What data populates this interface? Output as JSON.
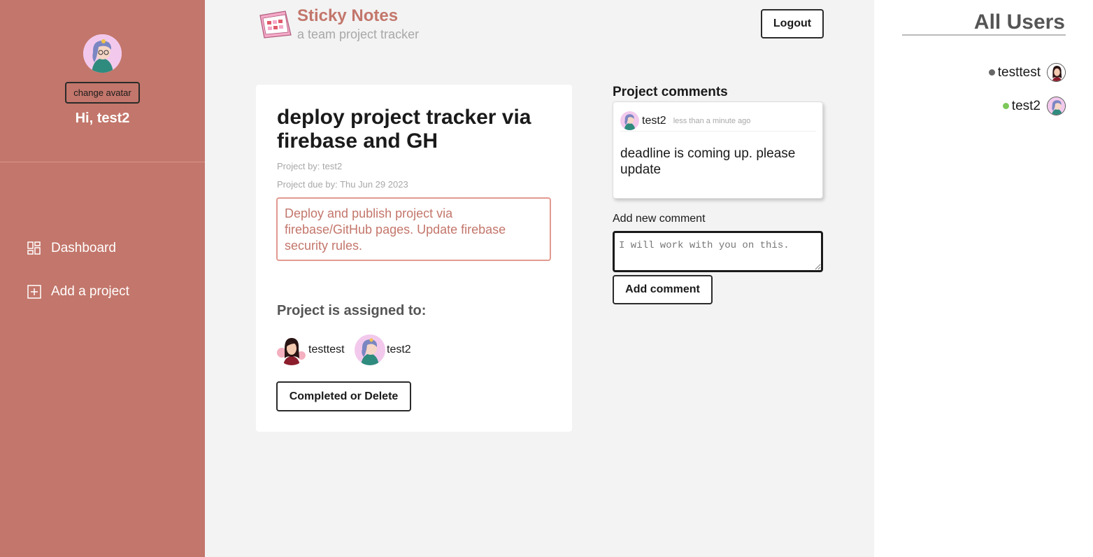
{
  "sidebar": {
    "change_avatar_label": "change avatar",
    "greeting": "Hi, test2",
    "nav": [
      {
        "label": "Dashboard",
        "icon": "dashboard-icon"
      },
      {
        "label": "Add a project",
        "icon": "add-square-icon"
      }
    ]
  },
  "header": {
    "brand_title": "Sticky Notes",
    "brand_subtitle": "a team project tracker",
    "logout_label": "Logout"
  },
  "project": {
    "title": "deploy project tracker via firebase and GH",
    "project_by": "Project by: test2",
    "due_by": "Project due by: Thu Jun 29 2023",
    "description": "Deploy and publish project via firebase/GitHub pages. Update firebase security rules.",
    "assigned_label": "Project is assigned to:",
    "assignees": [
      {
        "name": "testtest"
      },
      {
        "name": "test2"
      }
    ],
    "complete_label": "Completed or Delete"
  },
  "comments": {
    "heading": "Project comments",
    "items": [
      {
        "author": "test2",
        "time": "less than a minute ago",
        "body": "deadline is coming up. please update"
      }
    ],
    "add_label": "Add new comment",
    "input_placeholder": "I will work with you on this.",
    "add_button_label": "Add comment"
  },
  "users": {
    "title": "All Users",
    "list": [
      {
        "name": "testtest",
        "status_color": "#666666"
      },
      {
        "name": "test2",
        "status_color": "#7cc85a"
      }
    ]
  },
  "colors": {
    "sidebar_bg": "#c3766b",
    "accent": "#c3766b",
    "online": "#7cc85a",
    "offline": "#666666"
  }
}
